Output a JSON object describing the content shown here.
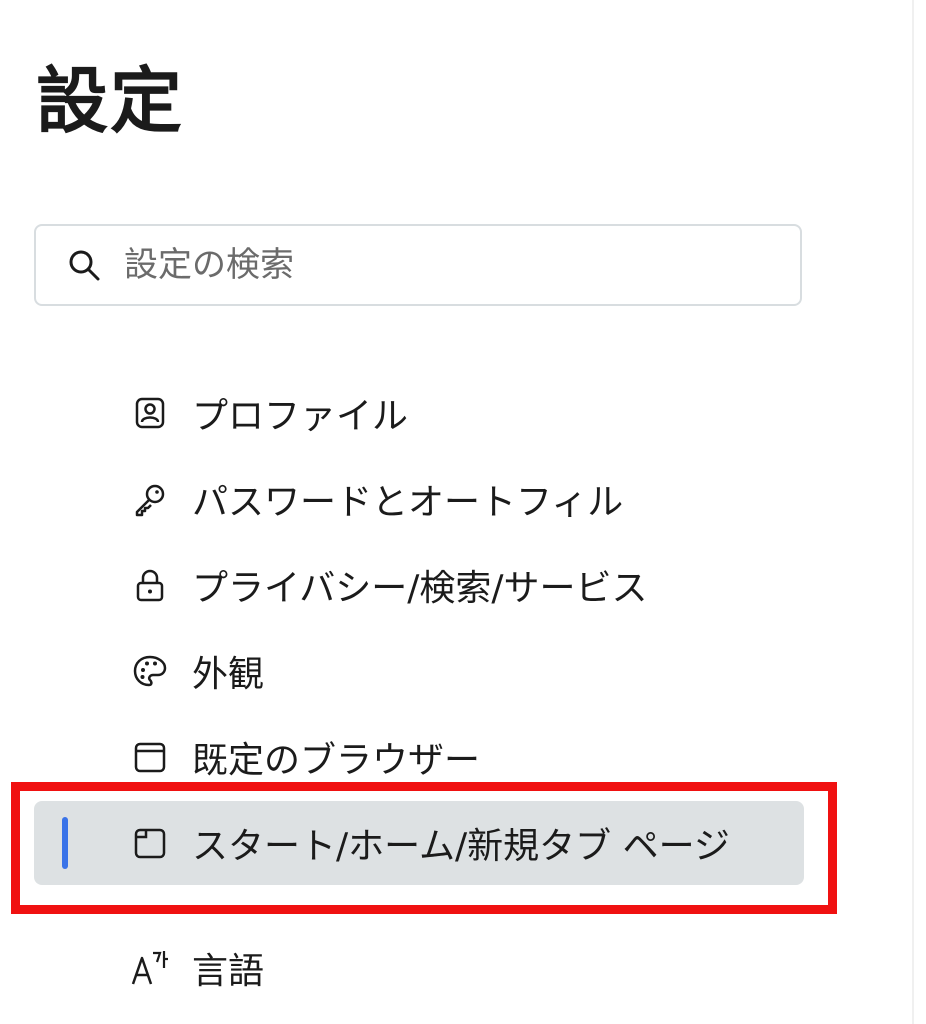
{
  "page": {
    "title": "設定"
  },
  "search": {
    "placeholder": "設定の検索",
    "value": "",
    "icon": "search-icon"
  },
  "nav": {
    "items": [
      {
        "label": "プロファイル",
        "icon": "profile-icon",
        "selected": false
      },
      {
        "label": "パスワードとオートフィル",
        "icon": "key-icon",
        "selected": false
      },
      {
        "label": "プライバシー/検索/サービス",
        "icon": "lock-icon",
        "selected": false
      },
      {
        "label": "外観",
        "icon": "palette-icon",
        "selected": false
      },
      {
        "label": "既定のブラウザー",
        "icon": "browser-icon",
        "selected": false
      },
      {
        "label": "スタート/ホーム/新規タブ ページ",
        "icon": "new-tab-icon",
        "selected": true
      },
      {
        "label": "言語",
        "icon": "language-icon",
        "selected": false
      }
    ]
  },
  "colors": {
    "accent": "#3a73e8",
    "selected_background": "#dde1e3",
    "highlight_box": "#f01111"
  }
}
